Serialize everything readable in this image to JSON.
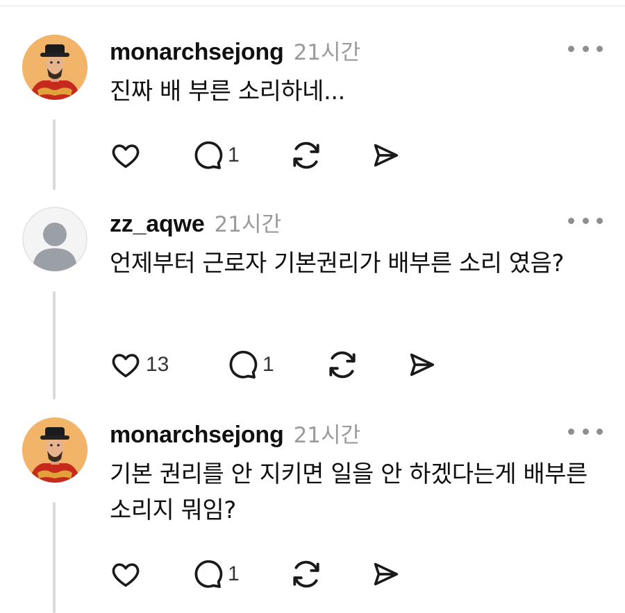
{
  "posts": [
    {
      "username": "monarchsejong",
      "time": "21시간",
      "text": "진짜 배 부른 소리하네...",
      "likes": "",
      "replies": "1",
      "avatar": "king-portrait"
    },
    {
      "username": "zz_aqwe",
      "time": "21시간",
      "text": "언제부터 근로자 기본권리가 배부른 소리 였음?",
      "likes": "13",
      "replies": "1",
      "avatar": "default-user"
    },
    {
      "username": "monarchsejong",
      "time": "21시간",
      "text": "기본 권리를 안 지키면 일을 안 하겠다는게 배부른 소리지 뭐임?",
      "likes": "",
      "replies": "1",
      "avatar": "king-portrait"
    }
  ],
  "colors": {
    "text": "#101010",
    "muted": "#9a9a9a",
    "thread_line": "#dadada",
    "icon": "#1a1a1a"
  }
}
